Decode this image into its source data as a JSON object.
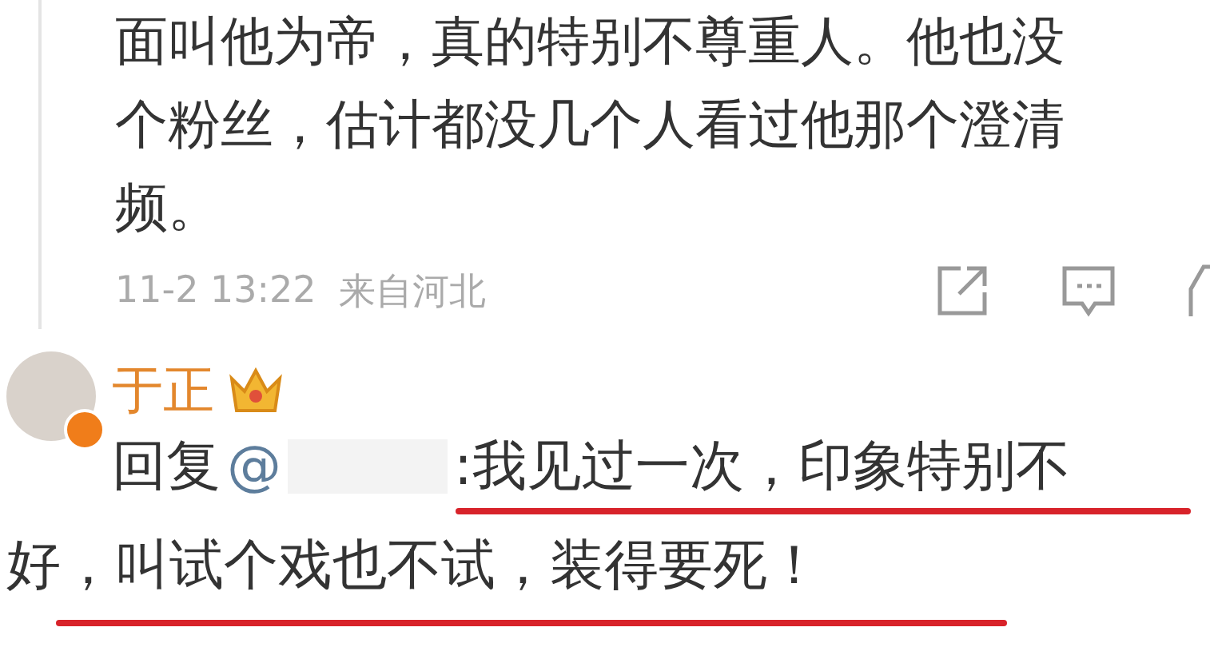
{
  "comment": {
    "lines": [
      "面叫他为帝，真的特别不尊重人。他也没",
      "个粉丝，估计都没几个人看过他那个澄清",
      "频。"
    ],
    "time": "11-2 13:22",
    "source": "来自河北"
  },
  "reply": {
    "author": "于正",
    "prefix": "回复",
    "mention": "@",
    "lines": [
      ":我见过一次，印象特别不",
      "好，叫试个戏也不试，装得要死！"
    ]
  }
}
